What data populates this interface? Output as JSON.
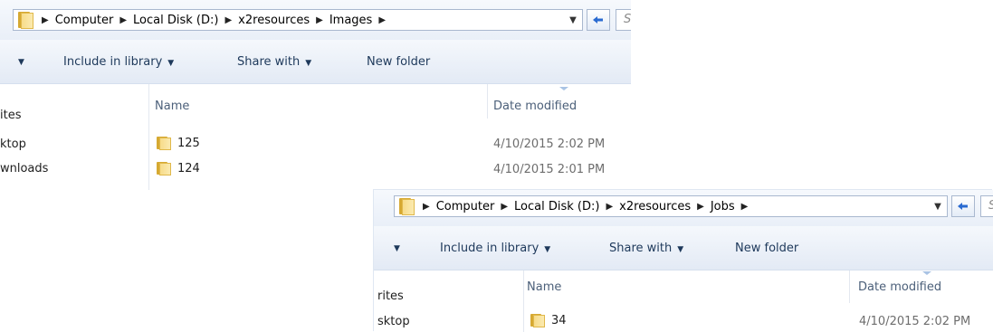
{
  "windows": [
    {
      "breadcrumb": [
        "Computer",
        "Local Disk (D:)",
        "x2resources",
        "Images"
      ],
      "search_placeholder": "Sea",
      "toolbar": {
        "include": "Include in library",
        "share": "Share with",
        "new_folder": "New folder"
      },
      "columns": {
        "name": "Name",
        "date": "Date modified"
      },
      "nav": [
        "ites",
        "ktop",
        "wnloads"
      ],
      "rows": [
        {
          "name": "125",
          "date": "4/10/2015 2:02 PM"
        },
        {
          "name": "124",
          "date": "4/10/2015 2:01 PM"
        }
      ]
    },
    {
      "breadcrumb": [
        "Computer",
        "Local Disk (D:)",
        "x2resources",
        "Jobs"
      ],
      "search_placeholder": "Se",
      "toolbar": {
        "include": "Include in library",
        "share": "Share with",
        "new_folder": "New folder"
      },
      "columns": {
        "name": "Name",
        "date": "Date modified"
      },
      "nav": [
        "rites",
        "sktop"
      ],
      "rows": [
        {
          "name": "34",
          "date": "4/10/2015 2:02 PM"
        }
      ]
    }
  ],
  "icons": {
    "folder": "folder-icon",
    "arrow": "breadcrumb-arrow-icon",
    "refresh": "refresh-icon",
    "dropdown": "chevron-down-icon"
  },
  "colors": {
    "accent": "#1e395b",
    "toolbar": "#e3eaf5",
    "folder": "#f7dc8a"
  }
}
